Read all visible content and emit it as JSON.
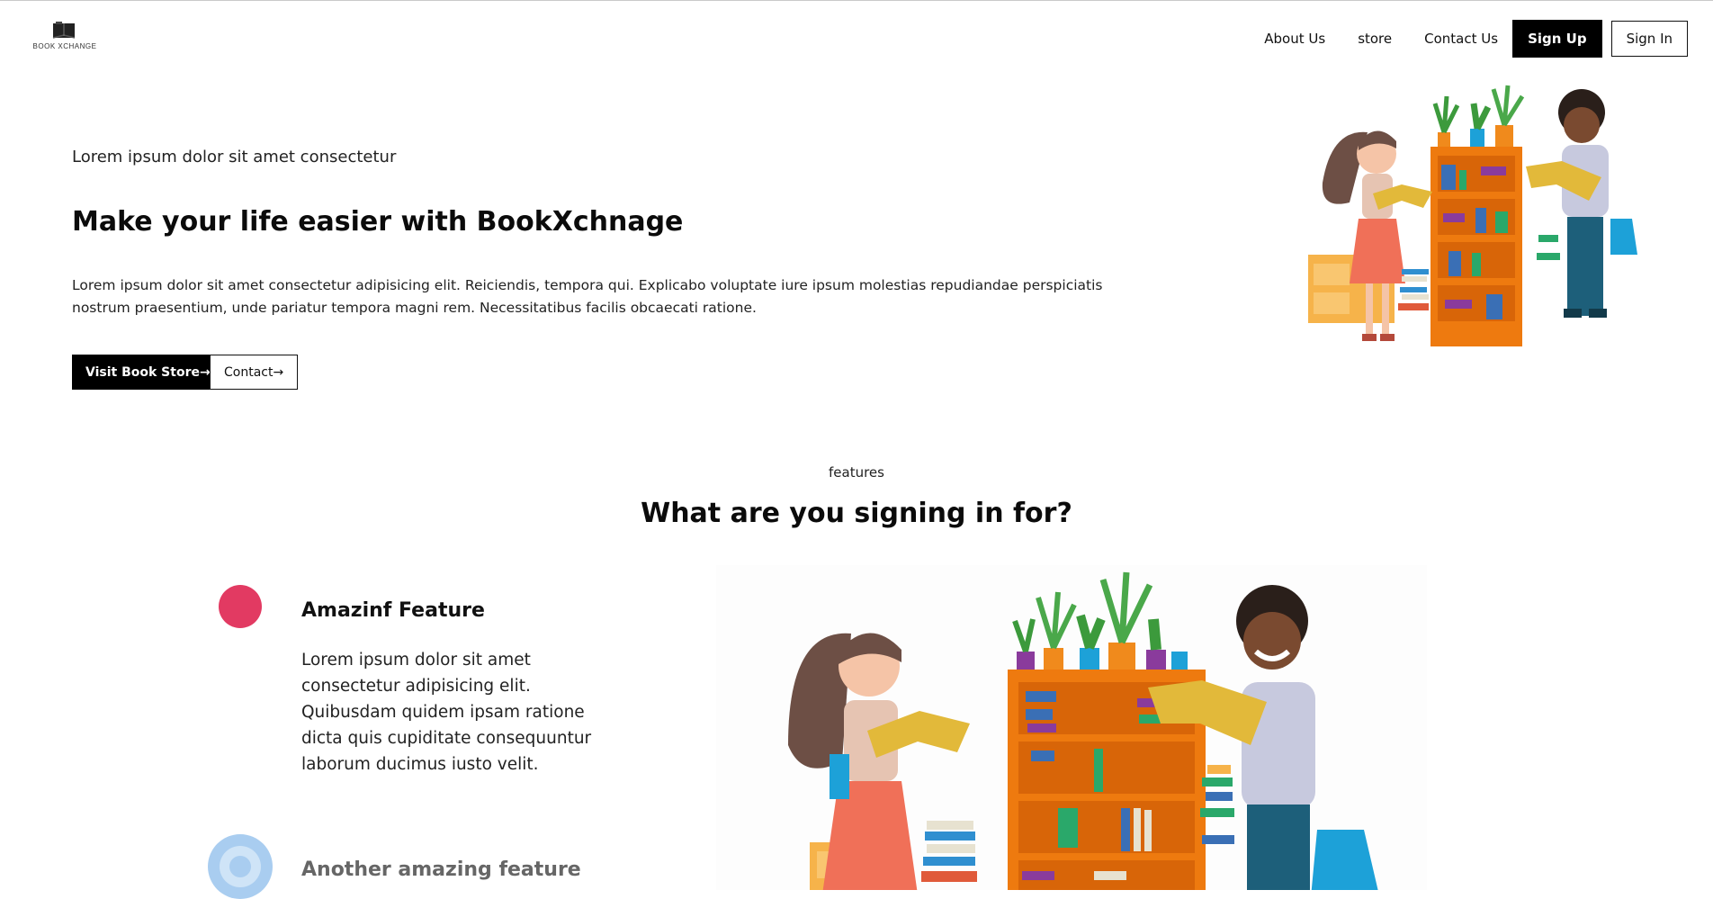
{
  "header": {
    "logo_text": "BOOK XCHANGE",
    "nav": [
      {
        "label": "About Us"
      },
      {
        "label": "store"
      },
      {
        "label": "Contact Us"
      }
    ],
    "signup_label": "Sign Up",
    "signin_label": "Sign In"
  },
  "hero": {
    "kicker": "Lorem ipsum dolor sit amet consectetur",
    "title": "Make your life easier with BookXchnage",
    "body": "Lorem ipsum dolor sit amet consectetur adipisicing elit. Reiciendis, tempora qui. Explicabo voluptate iure ipsum molestias repudiandae perspiciatis nostrum praesentium, unde pariatur tempora magni rem. Necessitatibus facilis obcaecati ratione.",
    "primary_button": "Visit Book Store→",
    "secondary_button": "Contact→"
  },
  "features": {
    "kicker": "features",
    "title": "What are you signing in for?",
    "items": [
      {
        "title": "Amazinf Feature",
        "body": "Lorem ipsum dolor sit amet consectetur adipisicing elit. Quibusdam quidem ipsam ratione dicta quis cupiditate consequuntur laborum ducimus iusto velit."
      },
      {
        "title": "Another amazing feature"
      }
    ]
  },
  "colors": {
    "accent": "#000000",
    "feature_dot_1": "#e23a62",
    "feature_dot_2": "#a9cdf0",
    "shelf": "#ee7a0f"
  },
  "icons": {
    "logo": "open-book-icon"
  }
}
